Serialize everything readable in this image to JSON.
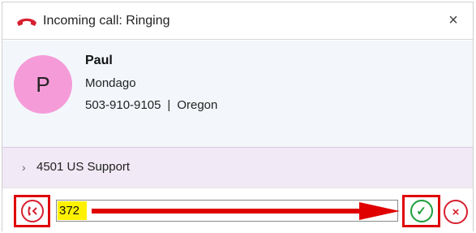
{
  "window": {
    "title": "Incoming call: Ringing",
    "close_symbol": "×"
  },
  "contact": {
    "avatar_initial": "P",
    "name": "Paul",
    "company": "Mondago",
    "phone": "503-910-9105",
    "separator": "|",
    "location": "Oregon"
  },
  "queue": {
    "chevron": "›",
    "label": "4501 US Support"
  },
  "actions": {
    "transfer_number": "372",
    "answer_symbol": "✓",
    "decline_symbol": "×"
  },
  "icons": {
    "title": "phone-handset-icon",
    "transfer": "transfer-call-icon",
    "answer": "check-icon",
    "decline": "close-icon"
  },
  "colors": {
    "accent_red": "#d7202f",
    "highlight_box": "#e00000",
    "answer_green": "#1e9e3a",
    "avatar": "#f59bd8",
    "queue_bg": "#f1e9f5",
    "input_highlight": "#fff200"
  }
}
